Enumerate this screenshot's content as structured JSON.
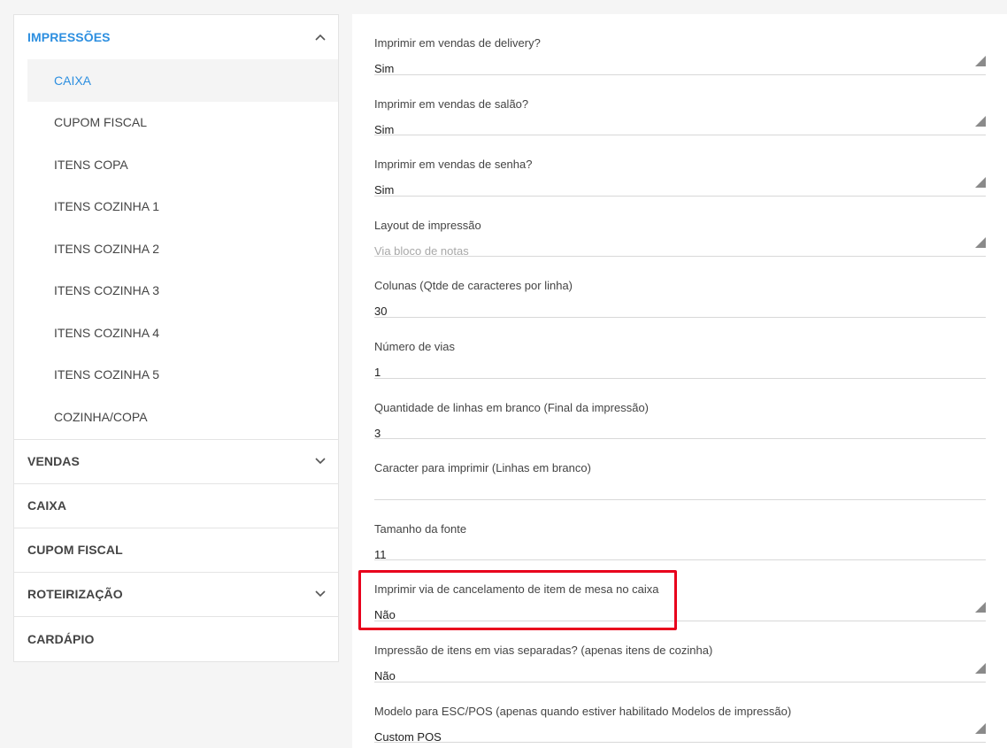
{
  "sidebar": {
    "impressoes": {
      "label": "IMPRESSÕES",
      "items": [
        {
          "label": "CAIXA",
          "active": true
        },
        {
          "label": "CUPOM FISCAL"
        },
        {
          "label": "ITENS COPA"
        },
        {
          "label": "ITENS COZINHA 1"
        },
        {
          "label": "ITENS COZINHA 2"
        },
        {
          "label": "ITENS COZINHA 3"
        },
        {
          "label": "ITENS COZINHA 4"
        },
        {
          "label": "ITENS COZINHA 5"
        },
        {
          "label": "COZINHA/COPA"
        }
      ]
    },
    "vendas": "VENDAS",
    "caixa": "CAIXA",
    "cupom_fiscal": "CUPOM FISCAL",
    "roteirizacao": "ROTEIRIZAÇÃO",
    "cardapio": "CARDÁPIO"
  },
  "form": {
    "fields": [
      {
        "label": "Imprimir em vendas de delivery?",
        "value": "Sim",
        "type": "select"
      },
      {
        "label": "Imprimir em vendas de salão?",
        "value": "Sim",
        "type": "select"
      },
      {
        "label": "Imprimir em vendas de senha?",
        "value": "Sim",
        "type": "select"
      },
      {
        "label": "Layout de impressão",
        "value": "Via bloco de notas",
        "type": "select",
        "placeholder": true
      },
      {
        "label": "Colunas (Qtde de caracteres por linha)",
        "value": "30",
        "type": "input"
      },
      {
        "label": "Número de vias",
        "value": "1",
        "type": "input"
      },
      {
        "label": "Quantidade de linhas em branco (Final da impressão)",
        "value": "3",
        "type": "input"
      },
      {
        "label": "Caracter para imprimir (Linhas em branco)",
        "value": "",
        "type": "input"
      },
      {
        "label": "Tamanho da fonte",
        "value": "11",
        "type": "input"
      },
      {
        "label": "Imprimir via de cancelamento de item de mesa no caixa",
        "value": "Não",
        "type": "select"
      },
      {
        "label": "Impressão de itens em vias separadas? (apenas itens de cozinha)",
        "value": "Não",
        "type": "select"
      },
      {
        "label": "Modelo para ESC/POS (apenas quando estiver habilitado Modelos de impressão)",
        "value": "Custom POS",
        "type": "select"
      }
    ]
  },
  "colors": {
    "accent": "#2d8fe0",
    "highlight": "#e8001c"
  }
}
